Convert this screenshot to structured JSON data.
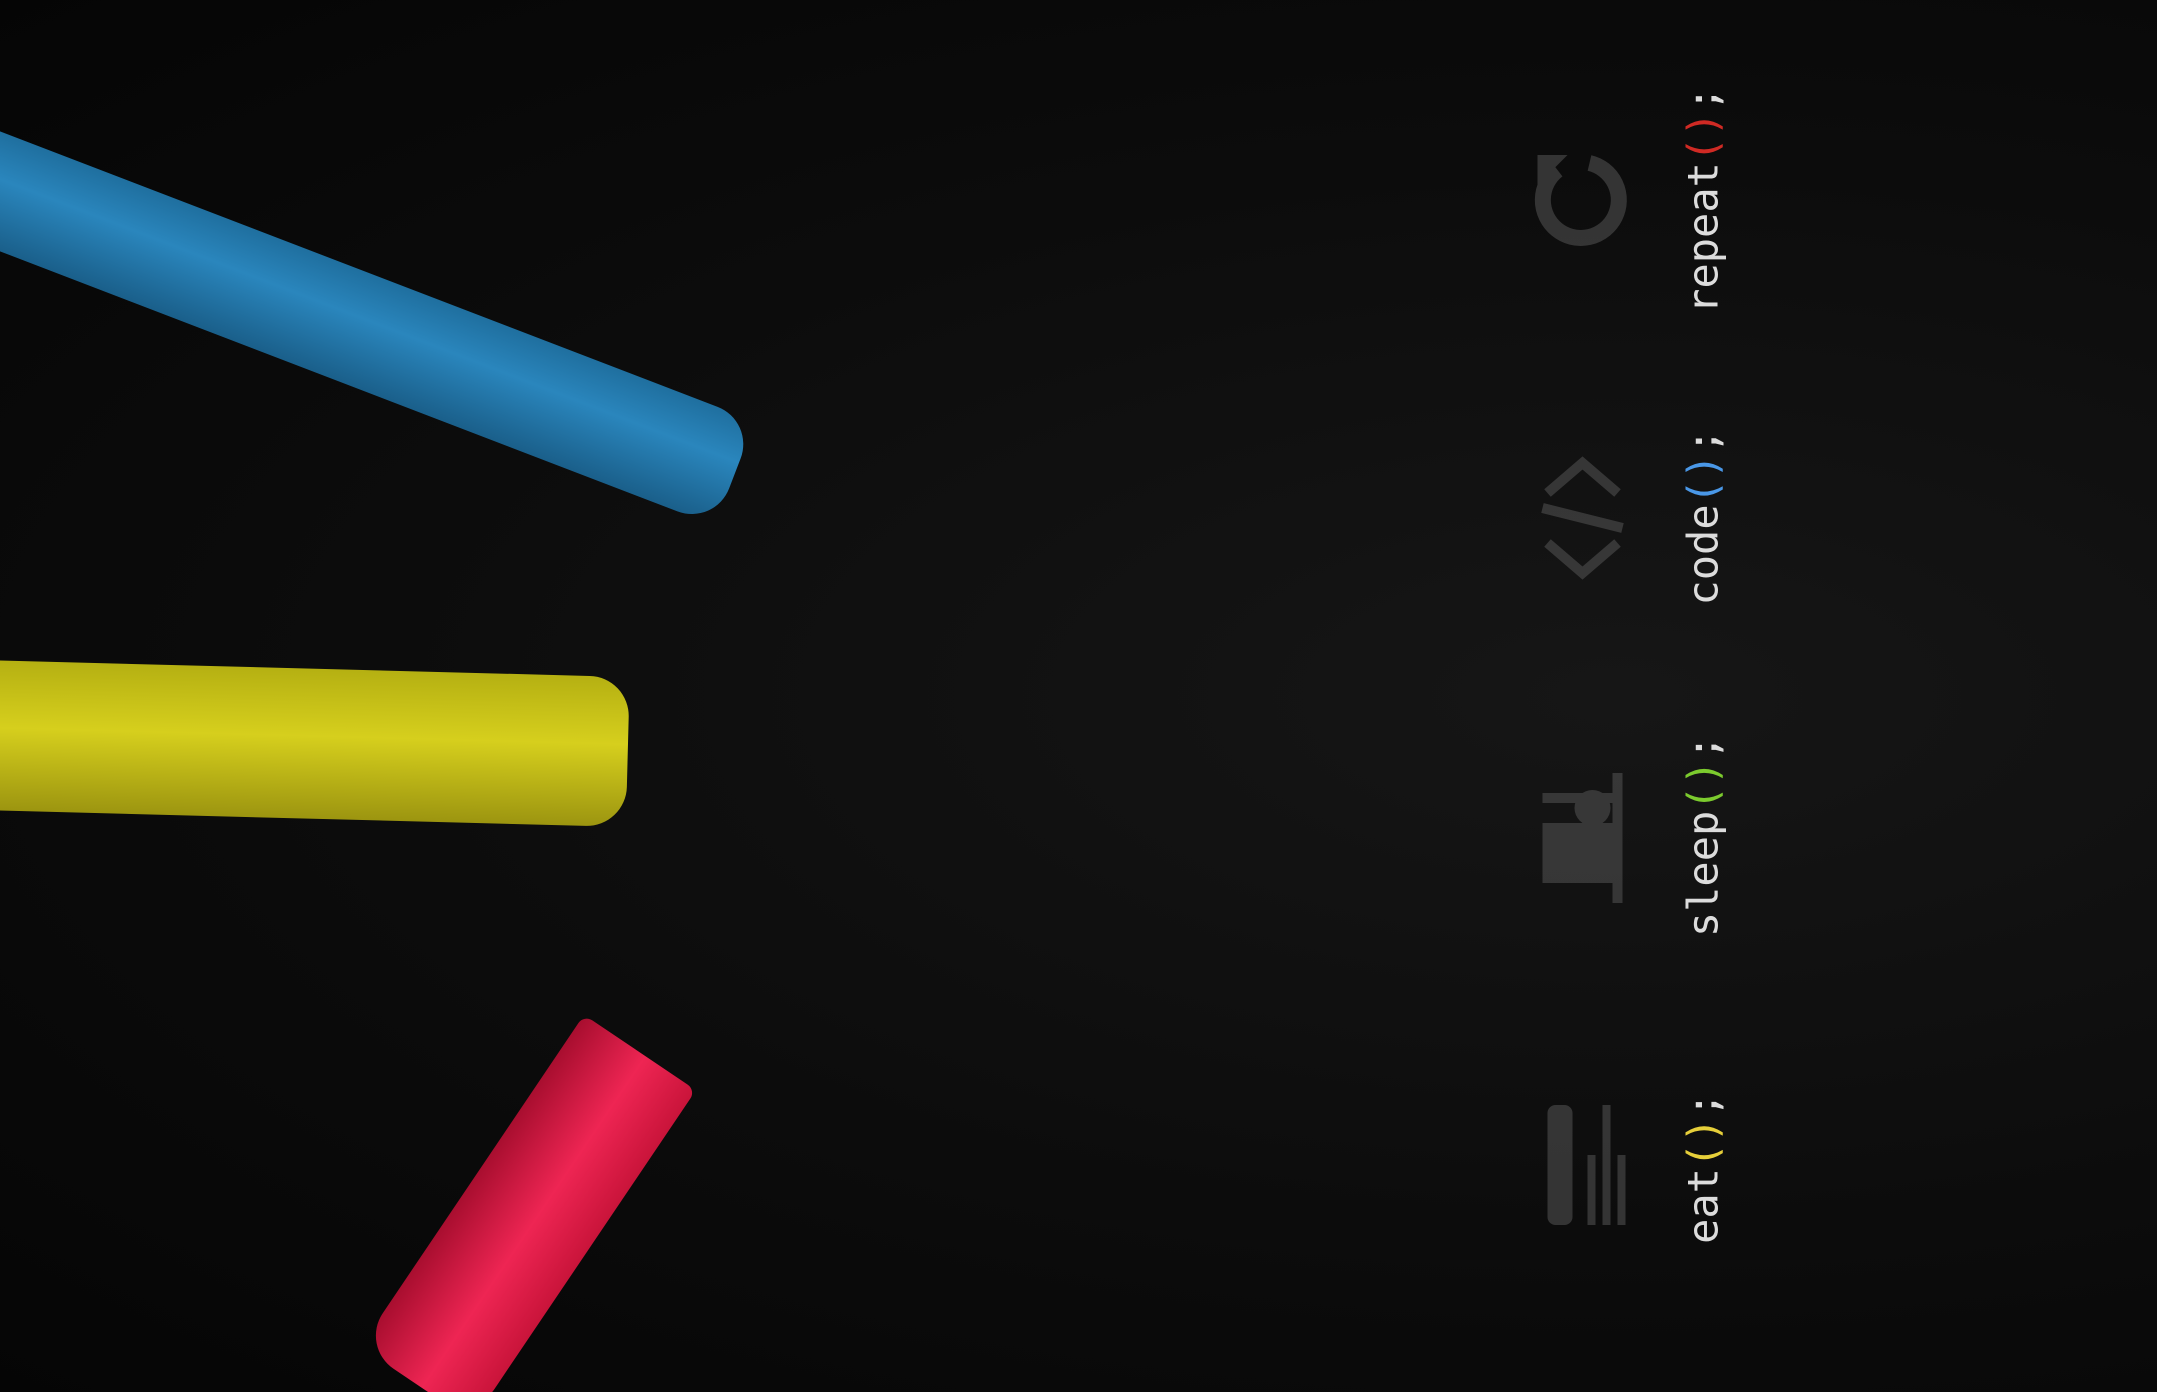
{
  "items": [
    {
      "name": "eat",
      "parens": "()",
      "semi": ";",
      "color": "#e6cf3a",
      "icon": "fork-knife-icon"
    },
    {
      "name": "sleep",
      "parens": "()",
      "semi": ";",
      "color": "#7ccb2e",
      "icon": "bed-icon"
    },
    {
      "name": "code",
      "parens": "()",
      "semi": ";",
      "color": "#4a98e8",
      "icon": "code-brackets-icon"
    },
    {
      "name": "repeat",
      "parens": "()",
      "semi": ";",
      "color": "#d02a24",
      "icon": "repeat-arrow-icon"
    }
  ],
  "chalk_colors": {
    "blue": "#2a86bd",
    "yellow": "#d6cf1d",
    "red": "#ee2553"
  }
}
